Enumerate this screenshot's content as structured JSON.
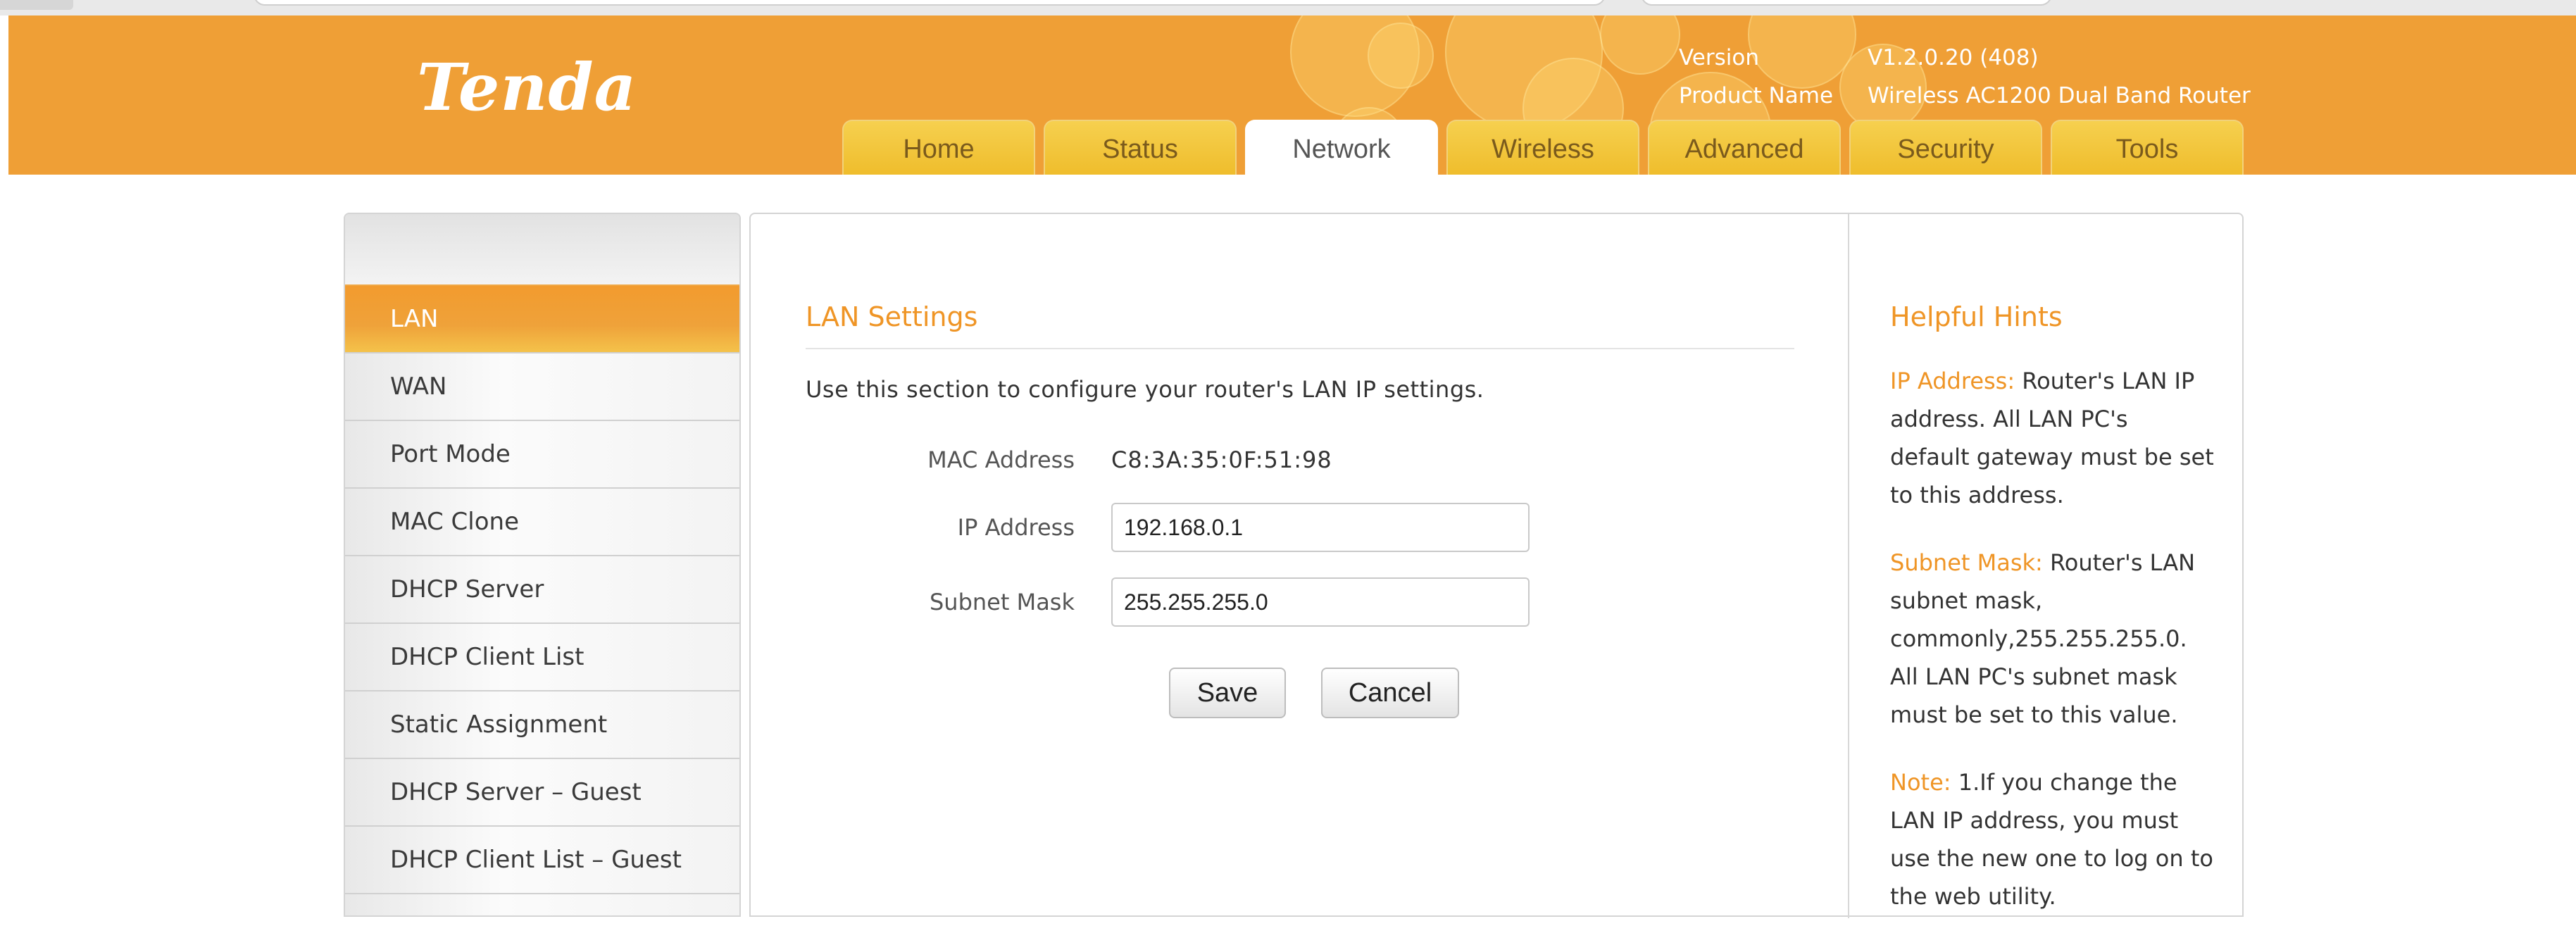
{
  "brand": {
    "logo_text": "Tenda",
    "color": "#ef9f36"
  },
  "header": {
    "version_label": "Version",
    "version_value": "V1.2.0.20 (408)",
    "product_label": "Product Name",
    "product_value": "Wireless AC1200 Dual Band Router"
  },
  "tabs": [
    {
      "label": "Home"
    },
    {
      "label": "Status"
    },
    {
      "label": "Network",
      "active": true
    },
    {
      "label": "Wireless"
    },
    {
      "label": "Advanced"
    },
    {
      "label": "Security"
    },
    {
      "label": "Tools"
    }
  ],
  "sidebar": {
    "items": [
      {
        "label": "LAN",
        "active": true
      },
      {
        "label": "WAN"
      },
      {
        "label": "Port Mode"
      },
      {
        "label": "MAC Clone"
      },
      {
        "label": "DHCP Server"
      },
      {
        "label": "DHCP Client List"
      },
      {
        "label": "Static Assignment"
      },
      {
        "label": "DHCP Server – Guest"
      },
      {
        "label": "DHCP Client List – Guest"
      }
    ]
  },
  "main": {
    "title": "LAN Settings",
    "intro": "Use this section to configure your router's LAN IP settings.",
    "mac_label": "MAC Address",
    "mac_value": "C8:3A:35:0F:51:98",
    "ip_label": "IP Address",
    "ip_value": "192.168.0.1",
    "mask_label": "Subnet Mask",
    "mask_value": "255.255.255.0",
    "save_label": "Save",
    "cancel_label": "Cancel"
  },
  "hints": {
    "title": "Helpful Hints",
    "ip_key": "IP Address:",
    "ip_text": "Router's LAN IP address. All LAN PC's default gateway must be set to this address.",
    "mask_key": "Subnet Mask:",
    "mask_text": "Router's LAN subnet mask, commonly,255.255.255.0. All LAN PC's subnet mask must be set to this value.",
    "note_key": "Note:",
    "note_text": "1.If you change the LAN IP address, you must use the new one to log on to the web utility."
  }
}
